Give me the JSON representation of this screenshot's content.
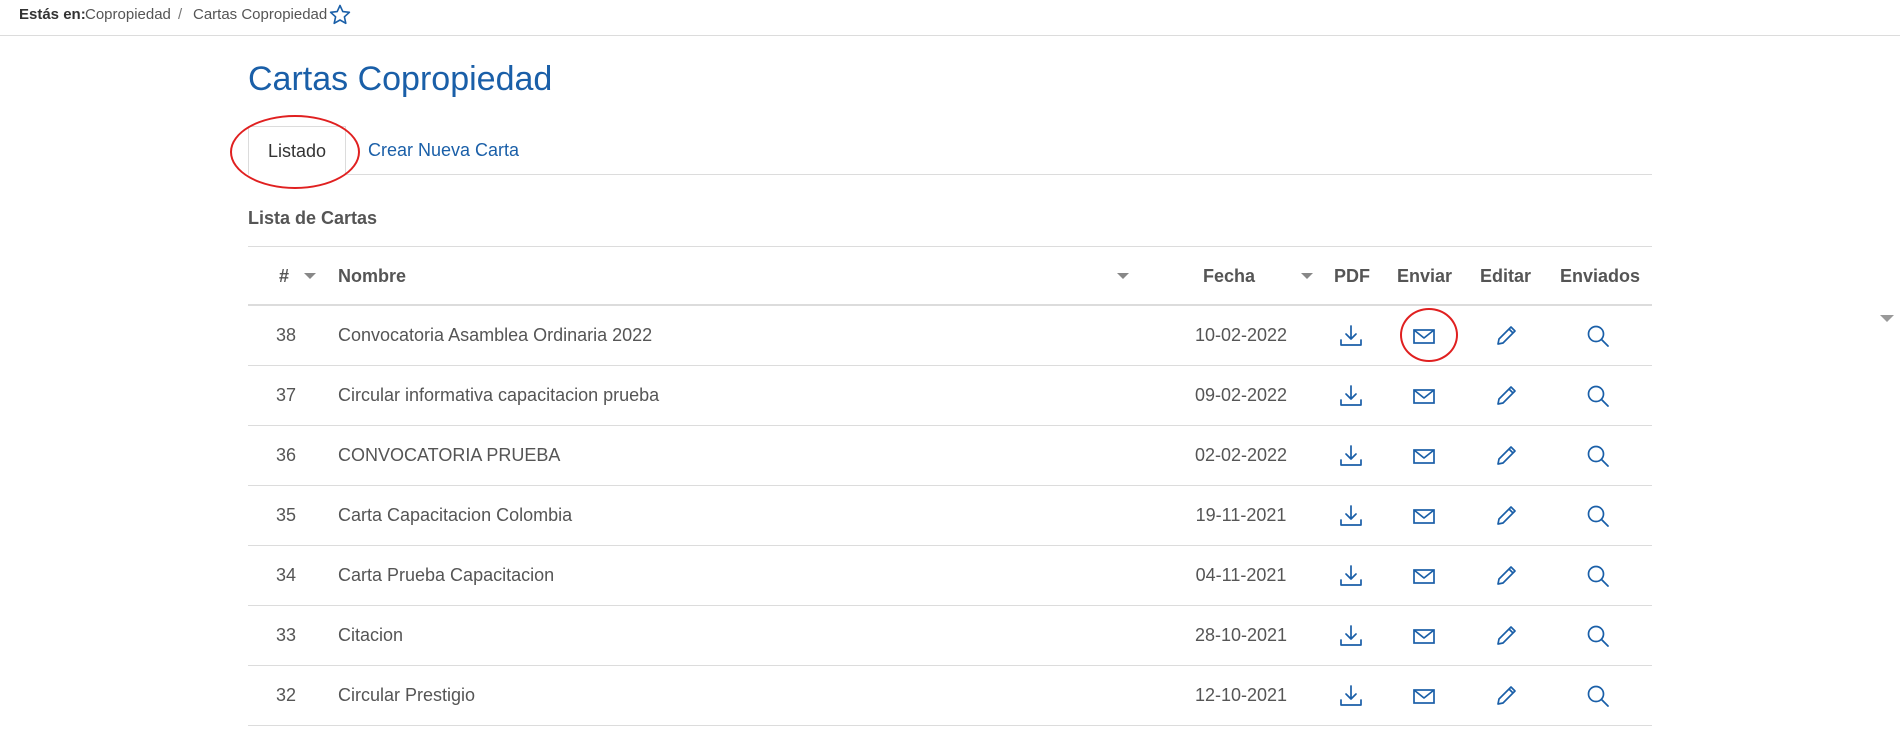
{
  "breadcrumb": {
    "prefix": "Estás en:",
    "home": "Copropiedad",
    "separator": "/",
    "current": "Cartas Copropiedad"
  },
  "page": {
    "title": "Cartas Copropiedad"
  },
  "tabs": {
    "listado": "Listado",
    "crear": "Crear Nueva Carta"
  },
  "section": {
    "title": "Lista de Cartas"
  },
  "table": {
    "headers": {
      "num": "#",
      "nombre": "Nombre",
      "fecha": "Fecha",
      "pdf": "PDF",
      "enviar": "Enviar",
      "editar": "Editar",
      "enviados": "Enviados"
    },
    "rows": [
      {
        "num": "38",
        "nombre": "Convocatoria Asamblea Ordinaria 2022",
        "fecha": "10-02-2022"
      },
      {
        "num": "37",
        "nombre": "Circular informativa capacitacion prueba",
        "fecha": "09-02-2022"
      },
      {
        "num": "36",
        "nombre": "CONVOCATORIA PRUEBA",
        "fecha": "02-02-2022"
      },
      {
        "num": "35",
        "nombre": "Carta Capacitacion Colombia",
        "fecha": "19-11-2021"
      },
      {
        "num": "34",
        "nombre": "Carta Prueba Capacitacion",
        "fecha": "04-11-2021"
      },
      {
        "num": "33",
        "nombre": "Citacion",
        "fecha": "28-10-2021"
      },
      {
        "num": "32",
        "nombre": "Circular Prestigio",
        "fecha": "12-10-2021"
      }
    ]
  },
  "icons": {
    "pdf": "download-icon",
    "enviar": "envelope-icon",
    "editar": "pencil-icon",
    "enviados": "magnifier-icon",
    "favorite": "star-icon"
  },
  "colors": {
    "accent": "#1a5fa8",
    "annotation": "#e02020",
    "border": "#dcdcdc"
  }
}
